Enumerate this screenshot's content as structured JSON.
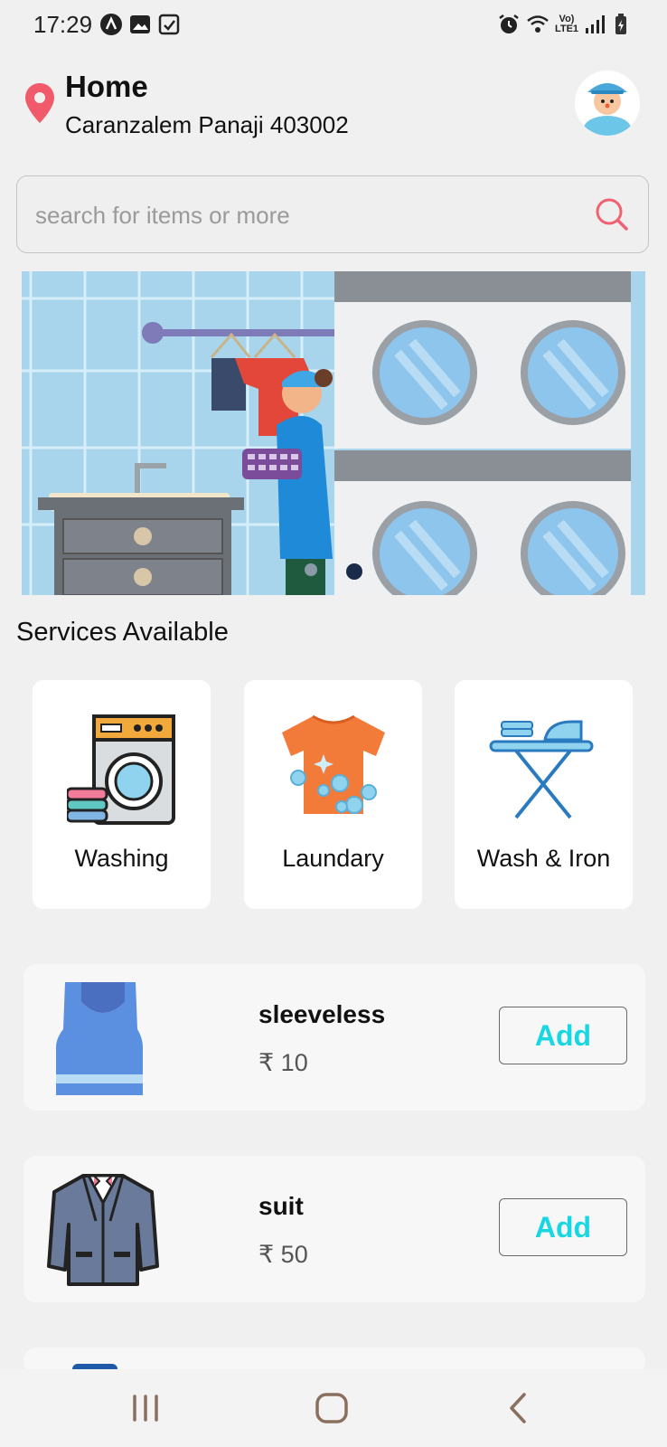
{
  "status_bar": {
    "time": "17:29",
    "network": "Vo) LTE1"
  },
  "header": {
    "location_name": "Home",
    "address": "Caranzalem Panaji 403002"
  },
  "search": {
    "placeholder": "search for items or more"
  },
  "banner": {
    "slides": 2,
    "active_slide": 2
  },
  "services": {
    "title": "Services Available",
    "items": [
      {
        "label": "Washing",
        "icon": "washing-machine-icon"
      },
      {
        "label": "Laundary",
        "icon": "tshirt-icon"
      },
      {
        "label": "Wash & Iron",
        "icon": "ironing-board-icon"
      }
    ]
  },
  "products": [
    {
      "name": "sleeveless",
      "price": "₹ 10",
      "add_label": "Add",
      "icon": "sleeveless-icon"
    },
    {
      "name": "suit",
      "price": "₹ 50",
      "add_label": "Add",
      "icon": "suit-icon"
    }
  ],
  "colors": {
    "accent": "#19d6e3",
    "pin": "#f05a6a",
    "search_icon": "#f06270"
  }
}
